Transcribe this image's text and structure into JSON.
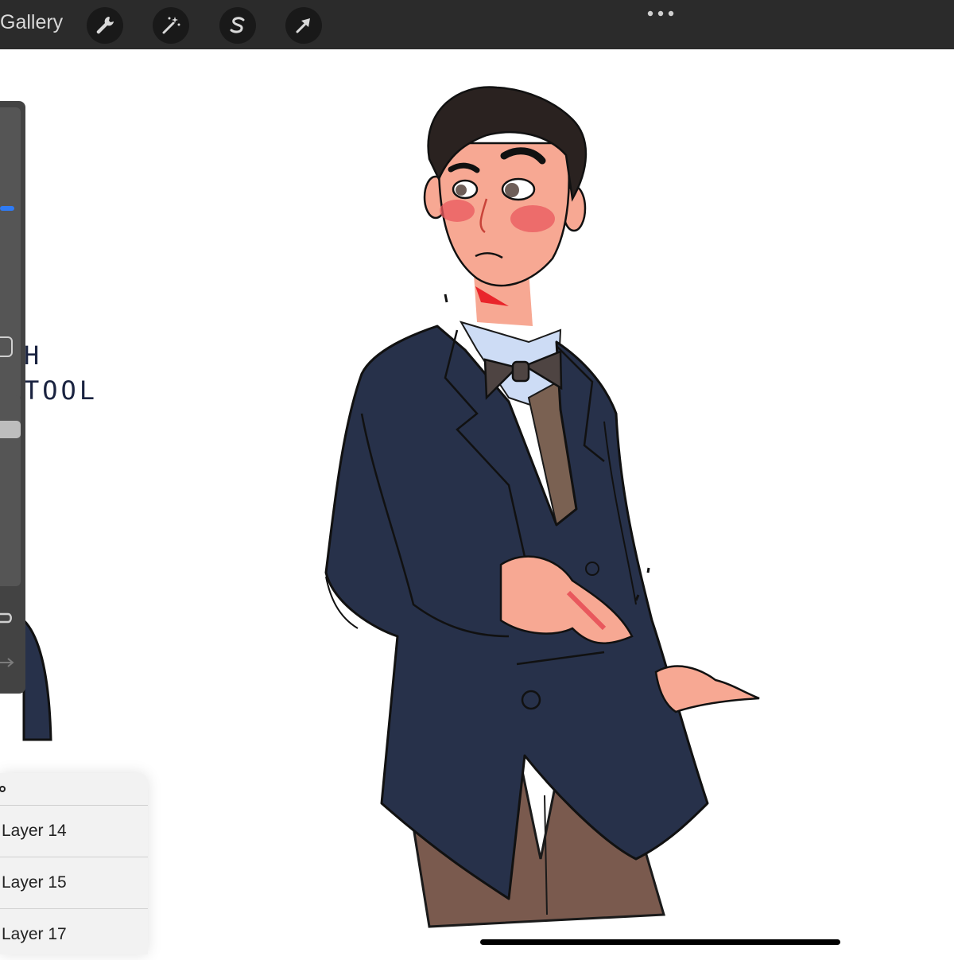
{
  "topbar": {
    "gallery_label": "Gallery",
    "tools": [
      {
        "name": "wrench-icon"
      },
      {
        "name": "magic-wand-icon"
      },
      {
        "name": "selection-icon"
      },
      {
        "name": "transform-arrow-icon"
      }
    ],
    "more_icon": "more-dots-icon"
  },
  "canvas": {
    "handwriting_lines": [
      "H",
      "TOOL"
    ]
  },
  "layers": {
    "items": [
      {
        "label": "Layer 14"
      },
      {
        "label": "Layer 15"
      },
      {
        "label": "Layer 17"
      }
    ]
  },
  "colors": {
    "toolbar": "#2b2b2b",
    "tool_button": "#191919",
    "sidebar": "#434343",
    "slider_accent": "#2f7bf5",
    "jacket": "#27314a",
    "skin": "#f7a893",
    "blush": "#e9585d",
    "hair": "#2a2220",
    "trousers": "#7a5a4e",
    "shirt": "#cddcf5",
    "bowtie": "#4e4442"
  }
}
